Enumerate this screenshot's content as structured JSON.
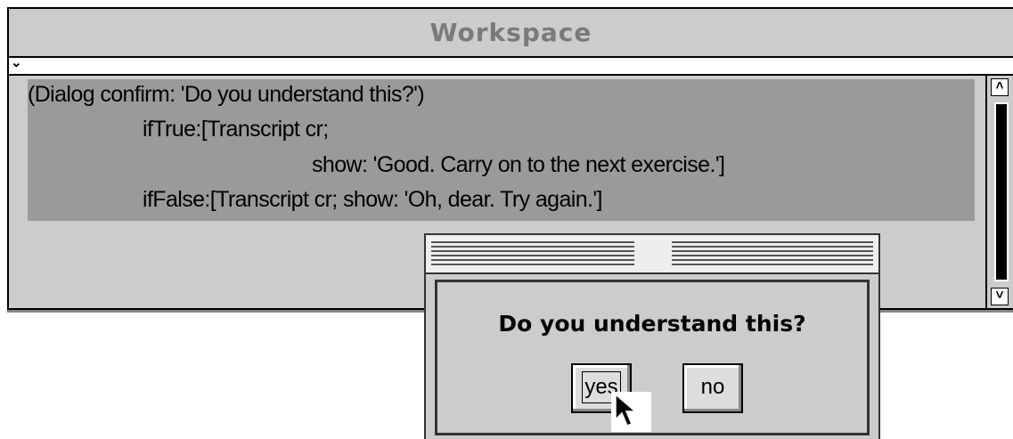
{
  "workspace": {
    "title": "Workspace",
    "menu_icon": "chevron-down-icon",
    "code_lines": [
      "(Dialog confirm: 'Do you understand this?')",
      "ifTrue:[Transcript cr;",
      "show: 'Good. Carry on to the next exercise.']",
      "ifFalse:[Transcript cr; show: 'Oh, dear. Try again.']"
    ]
  },
  "scrollbar": {
    "up_icon": "chevron-up-icon",
    "down_icon": "chevron-down-icon"
  },
  "dialog": {
    "message": "Do you understand this?",
    "yes_label": "yes",
    "no_label": "no"
  },
  "cursor": {
    "icon": "arrow-cursor-icon"
  }
}
